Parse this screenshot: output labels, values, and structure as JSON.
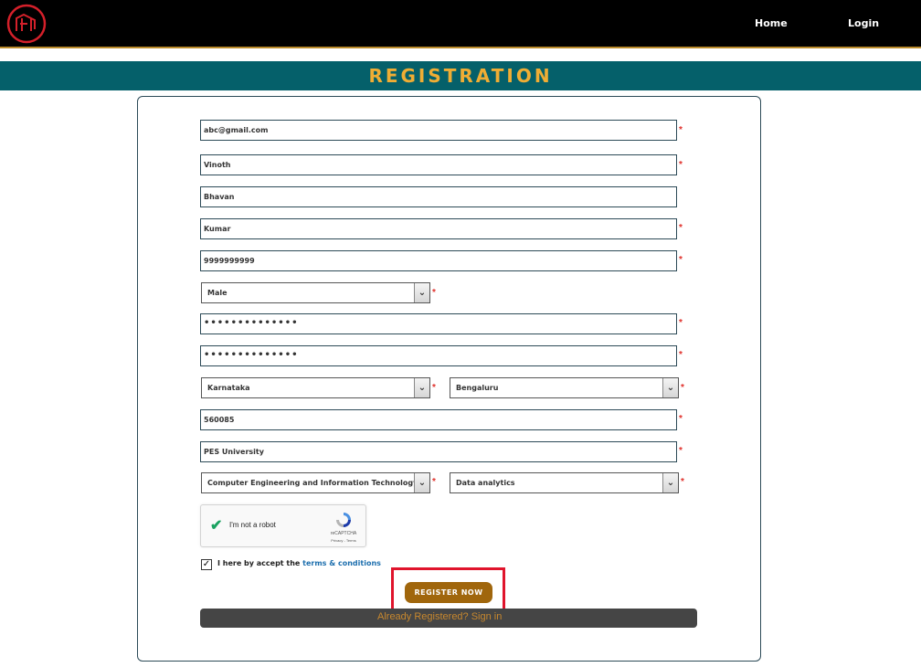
{
  "nav": {
    "home": "Home",
    "login": "Login"
  },
  "banner": {
    "title": "REGISTRATION"
  },
  "form": {
    "email": "abc@gmail.com",
    "first_name": "Vinoth",
    "middle_name": "Bhavan",
    "last_name": "Kumar",
    "phone": "9999999999",
    "gender": "Male",
    "password": "••••••••••••••",
    "confirm_password": "••••••••••••••",
    "state": "Karnataka",
    "city": "Bengaluru",
    "pincode": "560085",
    "college": "PES University",
    "department": "Computer Engineering and Information Technology",
    "interest": "Data analytics",
    "required_mark": "*"
  },
  "captcha": {
    "label": "I'm not a robot",
    "brand": "reCAPTCHA",
    "terms": "Privacy - Terms"
  },
  "terms": {
    "text": "I here by accept the ",
    "link": "terms & conditions"
  },
  "actions": {
    "register": "REGISTER NOW",
    "already": "Already Registered? Sign in"
  },
  "colors": {
    "banner_bg": "#05606a",
    "accent": "#f0ad34",
    "button": "#a0660c",
    "highlight": "#e0142c"
  },
  "icons": {
    "logo": "logo-icon",
    "check": "checkmark-icon",
    "recaptcha": "recaptcha-icon",
    "dropdown": "chevron-down-icon"
  }
}
